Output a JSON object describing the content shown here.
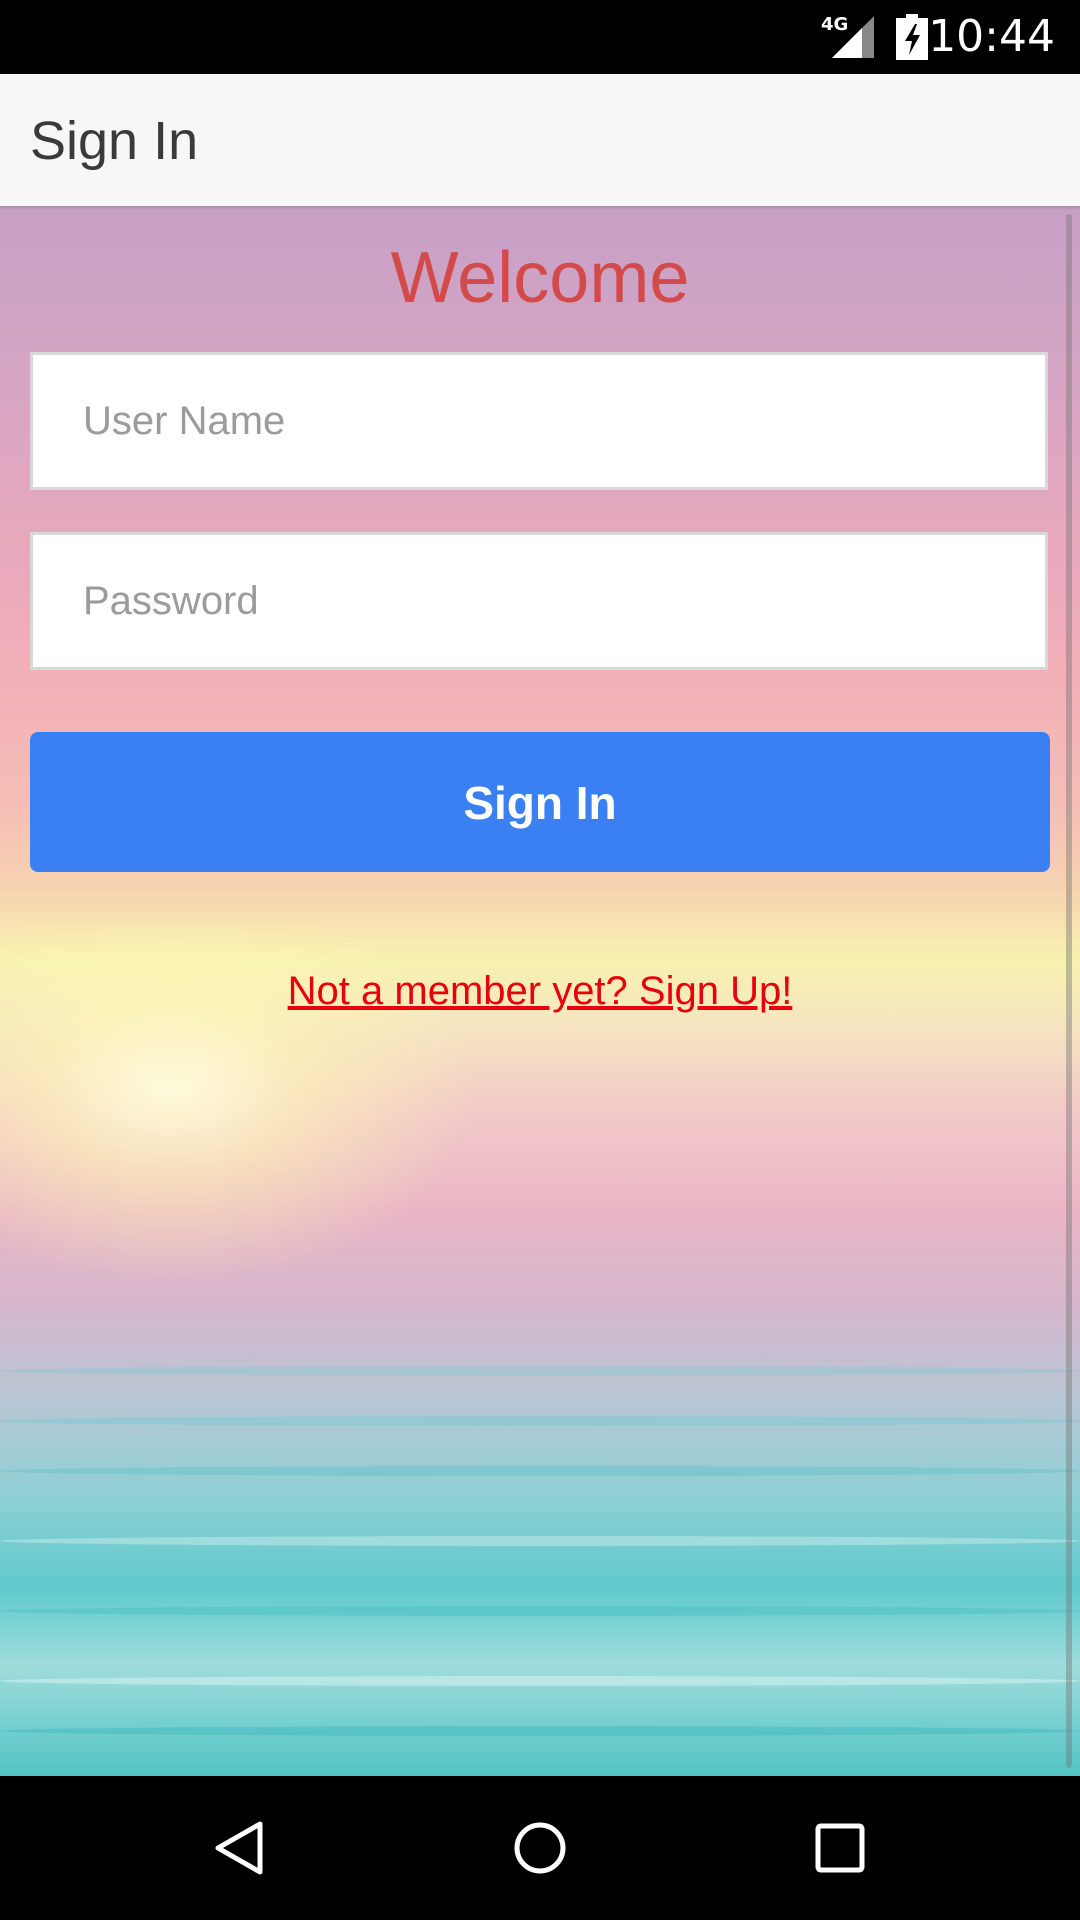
{
  "status_bar": {
    "network": "4G",
    "time": "10:44"
  },
  "toolbar": {
    "title": "Sign In"
  },
  "form": {
    "welcome": "Welcome",
    "username_placeholder": "User Name",
    "username_value": "",
    "password_placeholder": "Password",
    "password_value": "",
    "signin_label": "Sign In",
    "signup_link": "Not a member yet? Sign Up!"
  },
  "colors": {
    "welcome_text": "#d24a4a",
    "button_bg": "#3b80f2",
    "link_text": "#e8000a",
    "toolbar_bg": "#f7f7f7"
  },
  "icons": {
    "status": [
      "signal-icon",
      "battery-icon"
    ],
    "nav": [
      "back-icon",
      "home-icon",
      "recents-icon"
    ]
  }
}
